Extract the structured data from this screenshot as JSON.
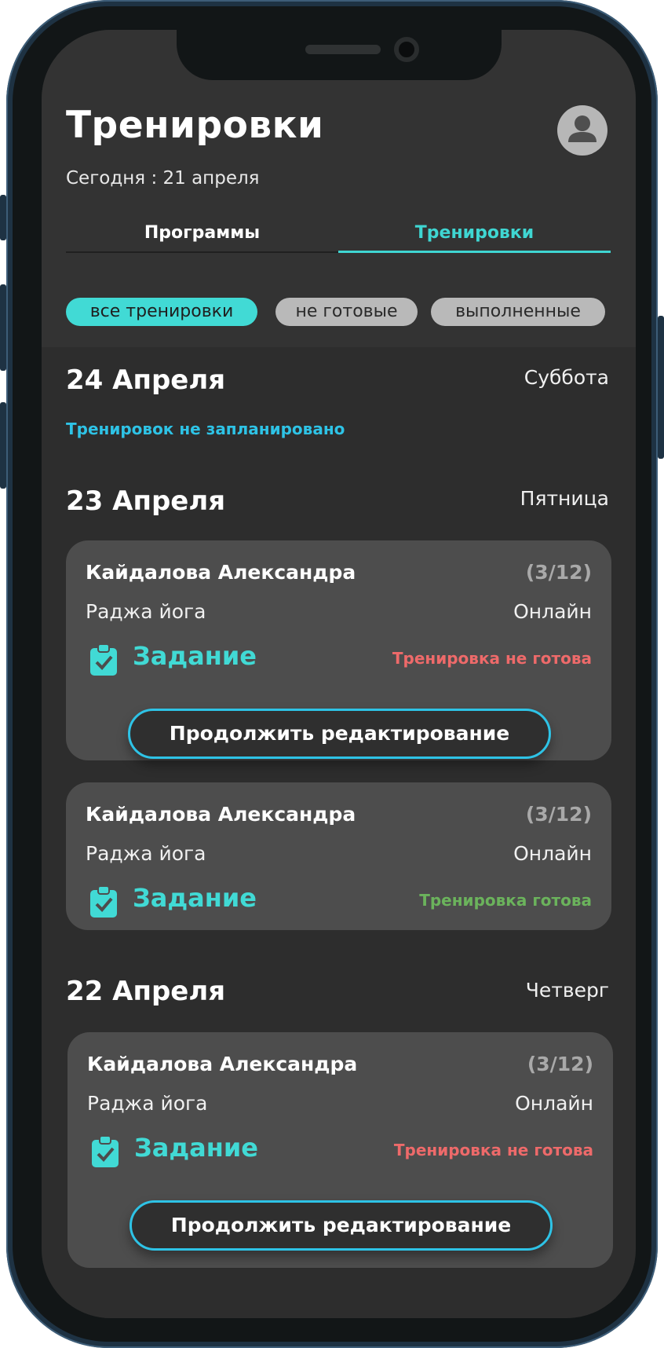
{
  "header": {
    "title": "Тренировки",
    "today": "Сегодня : 21 апреля"
  },
  "tabs": [
    {
      "label": "Программы",
      "active": false
    },
    {
      "label": "Тренировки",
      "active": true
    }
  ],
  "filters": [
    {
      "label": "все тренировки",
      "active": true
    },
    {
      "label": "не готовые",
      "active": false
    },
    {
      "label": "выполненные",
      "active": false
    }
  ],
  "days": [
    {
      "date": "24 Апреля",
      "weekday": "Суббота",
      "empty_text": "Тренировок не запланировано"
    },
    {
      "date": "23 Апреля",
      "weekday": "Пятница",
      "cards": [
        {
          "name": "Кайдалова Александра",
          "count": "(3/12)",
          "kind": "Раджа йога",
          "mode": "Онлайн",
          "task": "Задание",
          "status": "Тренировка не готова",
          "button": "Продолжить редактирование"
        },
        {
          "name": "Кайдалова Александра",
          "count": "(3/12)",
          "kind": "Раджа йога",
          "mode": "Онлайн",
          "task": "Задание",
          "status": "Тренировка готова"
        }
      ]
    },
    {
      "date": "22 Апреля",
      "weekday": "Четверг",
      "cards": [
        {
          "name": "Кайдалова Александра",
          "count": "(3/12)",
          "kind": "Раджа йога",
          "mode": "Онлайн",
          "task": "Задание",
          "status": "Тренировка не готова",
          "button": "Продолжить редактирование"
        }
      ]
    }
  ],
  "colors": {
    "accent": "#41dad5",
    "link": "#2ec3e6",
    "not_ready": "#ee6a6a",
    "ready": "#6bb35c",
    "card": "#4d4d4d",
    "background": "#2d2d2d"
  },
  "icons": {
    "avatar": "user-avatar-icon",
    "task": "clipboard-check-icon"
  }
}
